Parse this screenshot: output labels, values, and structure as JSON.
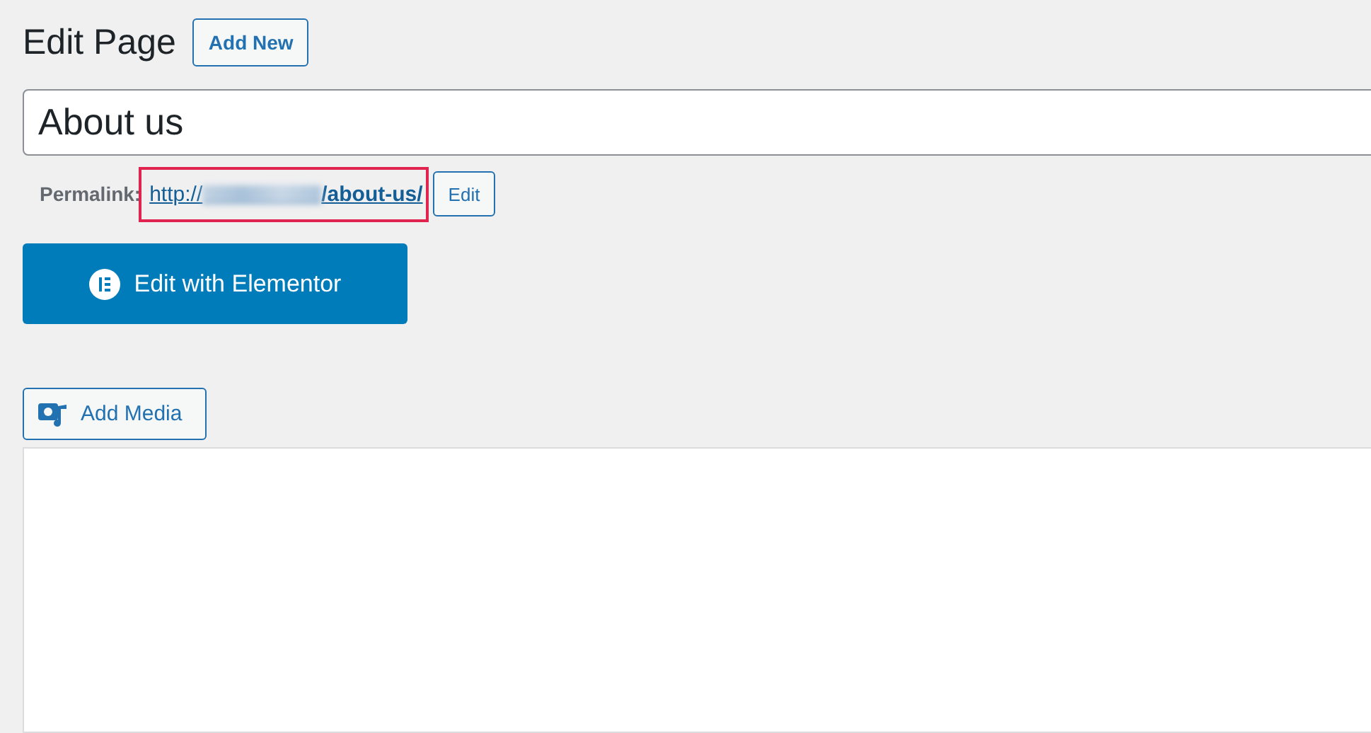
{
  "heading": "Edit Page",
  "add_new": "Add New",
  "title_value": "About us",
  "permalink": {
    "label": "Permalink:",
    "url_start": "http://",
    "url_end": "/about-us/",
    "highlighted": true
  },
  "edit_button": "Edit",
  "elementor_button": "Edit with Elementor",
  "add_media": "Add Media"
}
